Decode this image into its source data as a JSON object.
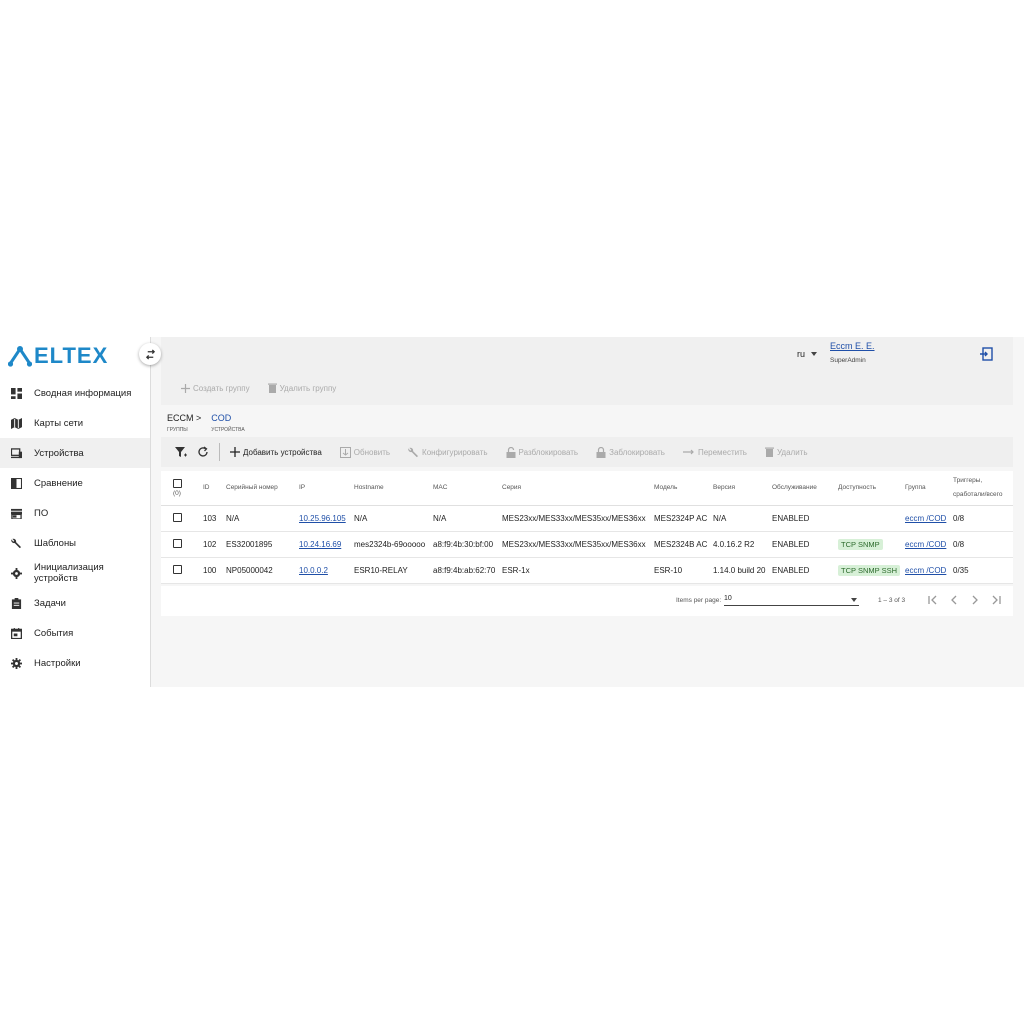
{
  "app": {
    "logo_text": "ELTEX",
    "brand_color": "#1E88C8"
  },
  "sidebar": {
    "items": [
      {
        "label": "Сводная информация",
        "icon": "dashboard-icon"
      },
      {
        "label": "Карты сети",
        "icon": "map-icon"
      },
      {
        "label": "Устройства",
        "icon": "devices-icon",
        "active": true
      },
      {
        "label": "Сравнение",
        "icon": "compare-icon"
      },
      {
        "label": "ПО",
        "icon": "store-icon"
      },
      {
        "label": "Шаблоны",
        "icon": "wrench-icon"
      },
      {
        "label": "Инициализация устройств",
        "icon": "gear-icon"
      },
      {
        "label": "Задачи",
        "icon": "clipboard-icon"
      },
      {
        "label": "События",
        "icon": "calendar-icon"
      },
      {
        "label": "Настройки",
        "icon": "settings-icon"
      }
    ]
  },
  "header": {
    "lang": "ru",
    "user_name": "Eccm E. E.",
    "user_role": "SuperAdmin",
    "create_group": "Создать группу",
    "delete_group": "Удалить группу"
  },
  "breadcrumb": {
    "root": "ECCM >",
    "root_sub": "группы",
    "current": "COD",
    "current_sub": "устройства"
  },
  "toolbar": {
    "add": "Добавить устройства",
    "refresh": "Обновить",
    "configure": "Конфигурировать",
    "unlock": "Разблокировать",
    "lock": "Заблокировать",
    "move": "Переместить",
    "delete": "Удалить"
  },
  "table": {
    "selected_count": "(0)",
    "headers": {
      "id": "ID",
      "serial": "Серийный номер",
      "ip": "IP",
      "hostname": "Hostname",
      "mac": "MAC",
      "series": "Серия",
      "model": "Модель",
      "version": "Версия",
      "service": "Обслуживание",
      "availability": "Доступность",
      "group": "Группа",
      "triggers": "Триггеры, сработали/всего"
    },
    "rows": [
      {
        "id": "103",
        "serial": "N/A",
        "ip": "10.25.96.105",
        "hostname": "N/A",
        "mac": "N/A",
        "series": "MES23xx/MES33xx/MES35xx/MES36xx",
        "model": "MES2324P AC",
        "version": "N/A",
        "service": "ENABLED",
        "availability": "",
        "group": "eccm /COD",
        "triggers": "0/8"
      },
      {
        "id": "102",
        "serial": "ES32001895",
        "ip": "10.24.16.69",
        "hostname": "mes2324b-69ooooo",
        "mac": "a8:f9:4b:30:bf:00",
        "series": "MES23xx/MES33xx/MES35xx/MES36xx",
        "model": "MES2324B AC",
        "version": "4.0.16.2 R2",
        "service": "ENABLED",
        "availability": "TCP  SNMP",
        "group": "eccm /COD",
        "triggers": "0/8"
      },
      {
        "id": "100",
        "serial": "NP05000042",
        "ip": "10.0.0.2",
        "hostname": "ESR10-RELAY",
        "mac": "a8:f9:4b:ab:62:70",
        "series": "ESR-1x",
        "model": "ESR-10",
        "version": "1.14.0 build 20",
        "service": "ENABLED",
        "availability": "TCP  SNMP  SSH",
        "group": "eccm /COD",
        "triggers": "0/35"
      }
    ]
  },
  "pager": {
    "items_per_page_label": "Items per page:",
    "items_per_page": "10",
    "range": "1 – 3 of 3"
  }
}
